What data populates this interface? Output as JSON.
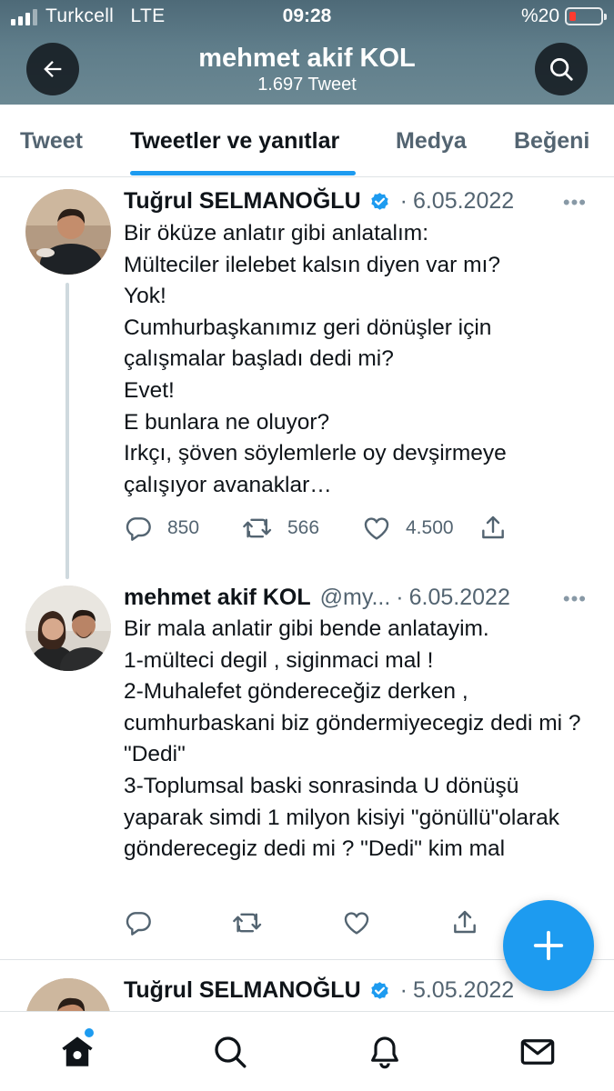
{
  "status_bar": {
    "carrier": "Turkcell",
    "network": "LTE",
    "time": "09:28",
    "battery": "%20",
    "battery_level": 0.2
  },
  "profile": {
    "name": "mehmet akif KOL",
    "tweet_count": "1.697 Tweet"
  },
  "tabs": [
    {
      "label": "Tweet",
      "active": false
    },
    {
      "label": "Tweetler ve yanıtlar",
      "active": true
    },
    {
      "label": "Medya",
      "active": false
    },
    {
      "label": "Beğeni",
      "active": false
    }
  ],
  "tweets": [
    {
      "author": "Tuğrul SELMANOĞLU",
      "verified": true,
      "handle": "",
      "separator": "·",
      "date": "6.05.2022",
      "more": "•••",
      "text": "Bir öküze anlatır gibi anlatalım:\nMülteciler ilelebet kalsın diyen var mı?\nYok!\nCumhurbaşkanımız geri dönüşler için çalışmalar başladı dedi mi?\nEvet!\nE bunlara ne oluyor?\nIrkçı, şöven söylemlerle oy devşirmeye çalışıyor avanaklar…",
      "replies": "850",
      "retweets": "566",
      "likes": "4.500"
    },
    {
      "author": "mehmet akif KOL",
      "verified": false,
      "handle": "@my...",
      "separator": "·",
      "date": "6.05.2022",
      "more": "•••",
      "text": "Bir mala anlatir gibi bende anlatayim.\n1-mülteci degil , siginmaci mal !\n2-Muhalefet göndereceğiz derken , cumhurbaskani biz göndermiyecegiz dedi mi ? \"Dedi\"\n3-Toplumsal baski sonrasinda U dönüşü yaparak simdi 1 milyon kisiyi \"gönüllü\"olarak gönderecegiz dedi mi ? \"Dedi\" kim mal",
      "replies": "",
      "retweets": "",
      "likes": ""
    },
    {
      "author": "Tuğrul SELMANOĞLU",
      "verified": true,
      "handle": "",
      "separator": "·",
      "date": "5.05.2022"
    }
  ],
  "icons": {
    "back": "arrow-left-icon",
    "search": "search-icon",
    "verified": "verified-badge-icon",
    "reply": "reply-icon",
    "retweet": "retweet-icon",
    "like": "heart-icon",
    "share": "share-icon",
    "compose": "plus-icon",
    "nav_home": "home-icon",
    "nav_search": "search-icon",
    "nav_notifications": "bell-icon",
    "nav_messages": "mail-icon"
  },
  "colors": {
    "accent": "#1d9bf0",
    "header_bg": "#5f7d8a",
    "battery_low": "#ff3b30"
  }
}
